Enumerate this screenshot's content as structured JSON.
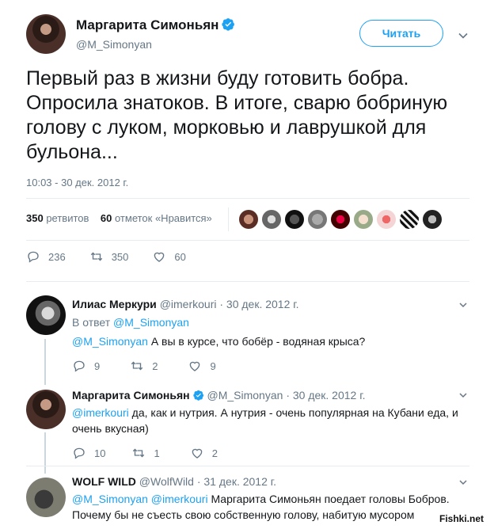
{
  "main": {
    "name": "Маргарита Симоньян",
    "handle": "@M_Simonyan",
    "follow_label": "Читать",
    "text": "Первый раз в жизни буду готовить бобра. Опросила знатоков. В итоге, сварю бобриную голову с луком, морковью и лаврушкой для бульона...",
    "time": "10:03 - 30 дек. 2012 г.",
    "retweets": "350",
    "retweets_label": "ретвитов",
    "likes": "60",
    "likes_label": "отметок «Нравится»",
    "actions": {
      "reply": "236",
      "retweet": "350",
      "like": "60"
    }
  },
  "replies": [
    {
      "name": "Илиас Меркури",
      "handle": "@imerkouri",
      "date": "· 30 дек. 2012 г.",
      "reply_prefix": "В ответ",
      "reply_to": "@M_Simonyan",
      "mention": "@M_Simonyan",
      "text": "А вы в курсе, что бобёр - водяная крыса?",
      "actions": {
        "reply": "9",
        "retweet": "2",
        "like": "9"
      }
    },
    {
      "name": "Маргарита Симоньян",
      "handle": "@M_Simonyan",
      "date": "· 30 дек. 2012 г.",
      "mention": "@imerkouri",
      "text": "да, как и нутрия. А нутрия - очень популярная на Кубани еда, и очень вкусная)",
      "actions": {
        "reply": "10",
        "retweet": "1",
        "like": "2"
      }
    },
    {
      "name": "WOLF WILD",
      "handle": "@WolfWild",
      "date": "· 31 дек. 2012 г.",
      "mention": "@M_Simonyan @imerkouri",
      "text": "Маргарита Симоньян поедает головы Бобров. Почему бы не съесть свою собственную голову, набитую мусором"
    }
  ],
  "watermark": "Fishki.net",
  "colors": {
    "accent": "#1da1f2",
    "secondary_text": "#657786",
    "primary_text": "#14171a"
  }
}
